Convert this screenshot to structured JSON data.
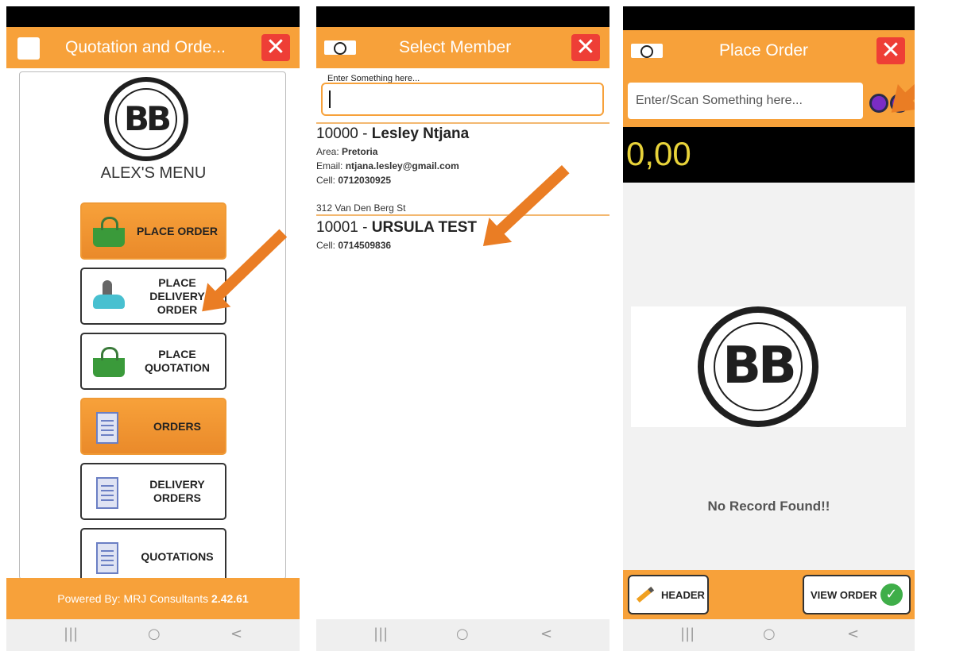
{
  "panel1": {
    "title": "Quotation and Orde...",
    "menu_heading": "ALEX'S MENU",
    "logo_letters": "BB",
    "buttons": [
      {
        "label": "PLACE ORDER"
      },
      {
        "label": "PLACE DELIVERY ORDER"
      },
      {
        "label": "PLACE QUOTATION"
      },
      {
        "label": "ORDERS"
      },
      {
        "label": "DELIVERY ORDERS"
      },
      {
        "label": "QUOTATIONS"
      }
    ],
    "footer": {
      "prefix": "Powered By: MRJ Consultants",
      "version": "2.42.61"
    }
  },
  "panel2": {
    "title": "Select Member",
    "search_caption": "Enter Something here...",
    "members": [
      {
        "code": "10000 - ",
        "name": "Lesley Ntjana",
        "area_label": "Area: ",
        "area": "Pretoria",
        "email_label": "Email: ",
        "email": "ntjana.lesley@gmail.com",
        "cell_label": "Cell: ",
        "cell": "0712030925",
        "address": "312 Van Den Berg St"
      },
      {
        "code": "10001 - ",
        "name": "URSULA TEST",
        "cell_label": "Cell: ",
        "cell": "0714509836"
      }
    ]
  },
  "panel3": {
    "title": "Place Order",
    "search_placeholder": "Enter/Scan Something here...",
    "total": "0,00",
    "logo_letters": "BB",
    "empty_message": "No Record Found!!",
    "header_button": "HEADER",
    "view_order_button": "VIEW ORDER"
  },
  "nav": {
    "recent": "|||",
    "home": "○",
    "back": "<"
  },
  "icons": {
    "close": "✕",
    "check": "✓"
  },
  "colors": {
    "accent": "#f7a13a",
    "close": "#ee3e36",
    "total": "#e8d33a",
    "success": "#3fae49"
  }
}
